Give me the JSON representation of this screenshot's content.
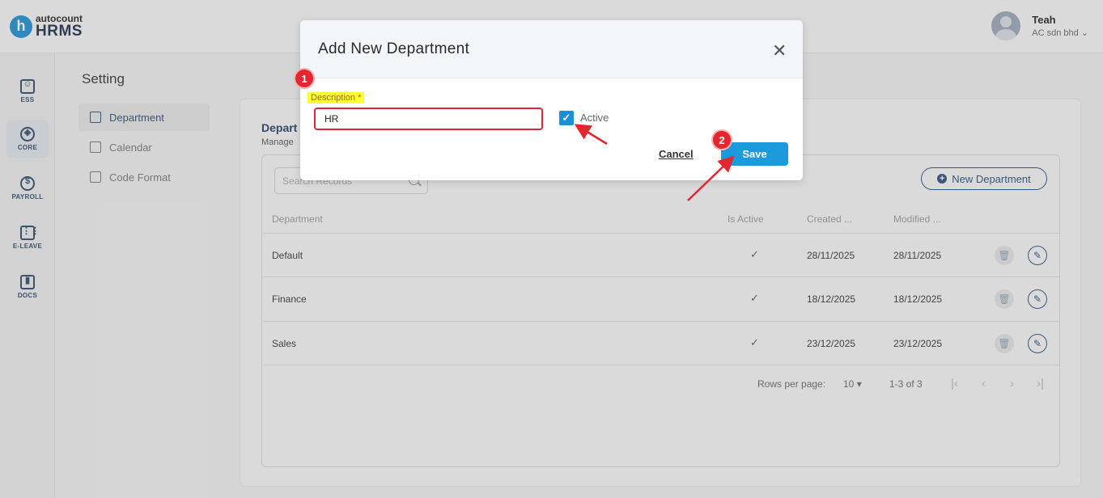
{
  "brand": {
    "logo_letter": "h",
    "small": "autocount",
    "big": "HRMS"
  },
  "user": {
    "name": "Teah",
    "company": "AC sdn bhd"
  },
  "sidebar": {
    "items": [
      {
        "label": "ESS",
        "glyph": ""
      },
      {
        "label": "CORE",
        "glyph": ""
      },
      {
        "label": "PAYROLL",
        "glyph": "$"
      },
      {
        "label": "E-LEAVE",
        "glyph": ""
      },
      {
        "label": "DOCS",
        "glyph": ""
      }
    ]
  },
  "settings": {
    "title": "Setting",
    "nav": [
      "Department",
      "Calendar",
      "Code Format"
    ]
  },
  "page": {
    "title": "Depart",
    "subtitle": "Manage",
    "search_placeholder": "Search Records",
    "new_button": "New Department"
  },
  "table": {
    "headers": [
      "Department",
      "Is Active",
      "Created ...",
      "Modified ..."
    ],
    "rows": [
      {
        "name": "Default",
        "active": "✓",
        "created": "28/11/2025",
        "modified": "28/11/2025"
      },
      {
        "name": "Finance",
        "active": "✓",
        "created": "18/12/2025",
        "modified": "18/12/2025"
      },
      {
        "name": "Sales",
        "active": "✓",
        "created": "23/12/2025",
        "modified": "23/12/2025"
      }
    ]
  },
  "pagination": {
    "rows_label": "Rows per page:",
    "rows_value": "10",
    "range": "1-3 of 3"
  },
  "modal": {
    "title": "Add New Department",
    "description_label": "Description *",
    "description_value": "HR",
    "active_label": "Active",
    "active_checked": true,
    "cancel": "Cancel",
    "save": "Save"
  },
  "annotations": {
    "step1": "1",
    "step2": "2"
  },
  "colors": {
    "accent": "#1b9bdb",
    "navy": "#2a4f7a",
    "annotation": "#e3262f",
    "highlight": "#ffff33"
  }
}
